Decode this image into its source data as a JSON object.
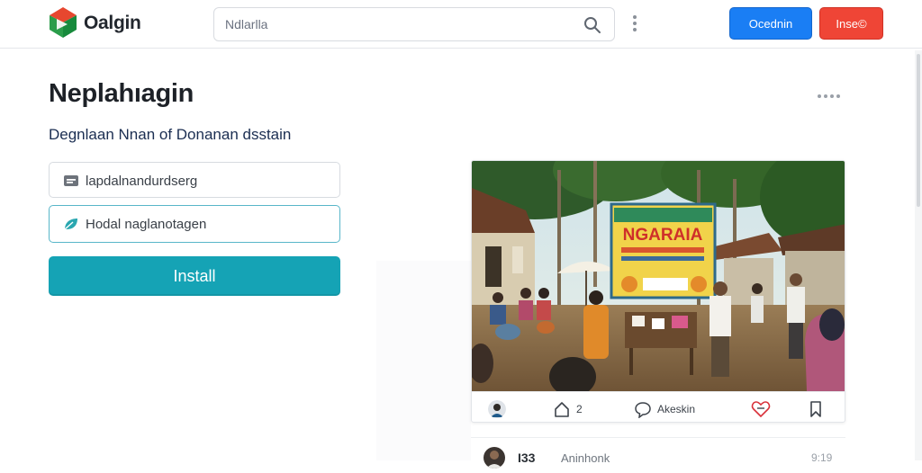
{
  "header": {
    "brand": "Oalgin",
    "search": {
      "placeholder": "Ndlarlla"
    },
    "primary_button": "Ocednin",
    "secondary_button": "Inse©"
  },
  "main": {
    "title": "Neplahıagin",
    "subtitle": "Degnlaan Nnan of Donanan dsstain",
    "fields": [
      {
        "placeholder": "lapdalnandurdserg",
        "icon": "id-card-icon"
      },
      {
        "placeholder": "Hodal naglanotagen",
        "icon": "leaf-icon"
      }
    ],
    "install_label": "Install"
  },
  "post": {
    "banner_text": "NGARAIA",
    "actions": {
      "like_count": "2",
      "comment_label": "Akeskin"
    },
    "comment": {
      "count": "I33",
      "name": "Aninhonk",
      "time": "9:19"
    }
  },
  "colors": {
    "primary": "#1a7ef4",
    "danger": "#ef4536",
    "install": "#15a3b5",
    "focus_border": "#58b6c9"
  }
}
